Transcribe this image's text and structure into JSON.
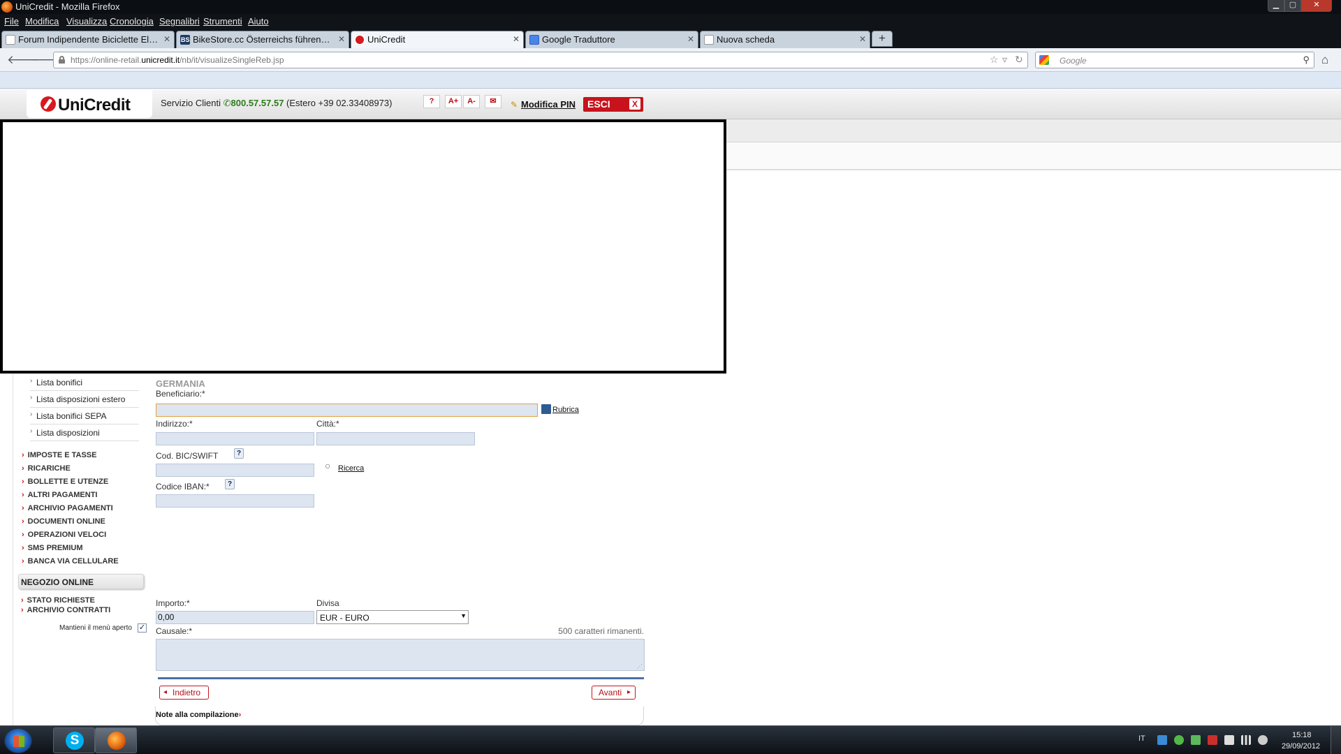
{
  "window": {
    "title": "UniCredit - Mozilla Firefox",
    "controls": {
      "minimize": "▁",
      "maximize": "▢",
      "close": "✕"
    }
  },
  "menubar": [
    "File",
    "Modifica",
    "Visualizza",
    "Cronologia",
    "Segnalibri",
    "Strumenti",
    "Aiuto"
  ],
  "tabs": [
    {
      "label": "Forum Indipendente Biciclette Elettric...",
      "close": "✕"
    },
    {
      "label": "BikeStore.cc Österreichs führender Fa...",
      "icon_text": "BS",
      "close": "✕"
    },
    {
      "label": "UniCredit",
      "close": "✕",
      "active": true
    },
    {
      "label": "Google Traduttore",
      "close": "✕"
    },
    {
      "label": "Nuova scheda",
      "close": "✕"
    }
  ],
  "new_tab": "+",
  "navbar": {
    "back": "🡐",
    "forward": "🡒",
    "url_prefix": "https://online-retail.",
    "url_domain": "unicredit.it",
    "url_path": "/nb/it/visualizeSingleReb.jsp",
    "bookmark_star": "☆",
    "dropdown": "▿",
    "reload": "↻",
    "search_placeholder": "Google",
    "search_button": "⚲",
    "home": "⌂"
  },
  "header": {
    "logo": "UniCredit",
    "service_label": "Servizio Clienti",
    "phone_icon": "✆",
    "phone": "800.57.57.57",
    "foreign": "(Estero +39 02.33408973)",
    "icons": {
      "help": "?",
      "font_up": "A+",
      "font_down": "A-",
      "mail": "✉"
    },
    "pin_icon": "✎",
    "pin_link": "Modifica PIN",
    "logout": "ESCI",
    "logout_x": "X"
  },
  "sidebar": {
    "submenu": [
      {
        "chev": "›",
        "label": "Lista bonifici"
      },
      {
        "chev": "›",
        "label": "Lista disposizioni estero"
      },
      {
        "chev": "›",
        "label": "Lista bonifici SEPA"
      },
      {
        "chev": "›",
        "label": "Lista disposizioni"
      }
    ],
    "menu": [
      {
        "arrow": "›",
        "label": "IMPOSTE E TASSE"
      },
      {
        "arrow": "›",
        "label": "RICARICHE"
      },
      {
        "arrow": "›",
        "label": "BOLLETTE E UTENZE"
      },
      {
        "arrow": "›",
        "label": "ALTRI PAGAMENTI"
      },
      {
        "arrow": "›",
        "label": "ARCHIVIO PAGAMENTI"
      },
      {
        "arrow": "›",
        "label": "DOCUMENTI ONLINE"
      },
      {
        "arrow": "›",
        "label": "OPERAZIONI VELOCI"
      },
      {
        "arrow": "›",
        "label": "SMS PREMIUM"
      },
      {
        "arrow": "›",
        "label": "BANCA VIA CELLULARE"
      }
    ],
    "section_title": "NEGOZIO ONLINE",
    "section_items": [
      {
        "arrow": "›",
        "label": "STATO RICHIESTE"
      },
      {
        "arrow": "›",
        "label": "ARCHIVIO CONTRATTI"
      }
    ],
    "keep_open_label": "Mantieni il menù aperto",
    "keep_open_check": "✓"
  },
  "form": {
    "country": "GERMANIA",
    "beneficiary_label": "Beneficiario:*",
    "beneficiary_value": "",
    "rubrica_link": "Rubrica",
    "address_label": "Indirizzo:*",
    "address_value": "",
    "city_label": "Città:*",
    "city_value": "",
    "bic_label": "Cod. BIC/SWIFT",
    "bic_value": "",
    "help_mark": "?",
    "ricerca_link": "Ricerca",
    "search_icon": "○",
    "iban_label": "Codice IBAN:*",
    "iban_value": "",
    "amount_label": "Importo:*",
    "amount_value": "0,00",
    "currency_label": "Divisa",
    "currency_value": "EUR - EURO",
    "currency_arrow": "▼",
    "causale_label": "Causale:*",
    "chars_remaining": "500 caratteri rimanenti.",
    "causale_value": "",
    "resize_grip": "⋰",
    "back_button": "Indietro",
    "back_arrow": "◂",
    "next_button": "Avanti",
    "next_arrow": "▸",
    "notes_label": "Note alla compilazione",
    "notes_chevron": "›"
  },
  "taskbar": {
    "skype_icon": "S",
    "language": "IT",
    "time": "15:18",
    "date": "29/09/2012"
  },
  "colors": {
    "brand_red": "#c8131c",
    "field_fill": "#dde5f1",
    "separator_blue": "#4d6fa6",
    "phone_green": "#2d7c1b"
  }
}
